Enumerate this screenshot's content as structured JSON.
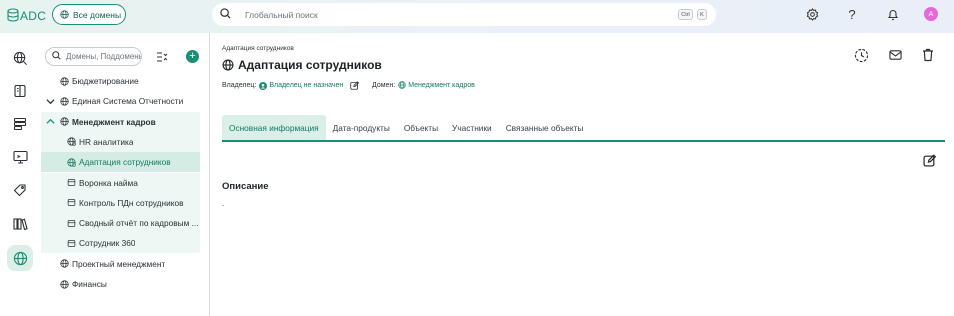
{
  "app": {
    "logo_text": "ADC",
    "brand_color": "#1a8f73"
  },
  "header": {
    "all_domains_label": "Все домены",
    "search_placeholder": "Глобальный поиск",
    "shortcut_keys": [
      "Ctrl",
      "K"
    ],
    "avatar_letter": "A"
  },
  "rail": {
    "icons": [
      "data-search-icon",
      "book-icon",
      "catalog-icon",
      "monitor-icon",
      "tag-icon",
      "library-icon",
      "globe-icon"
    ]
  },
  "tree": {
    "search_placeholder": "Домены, Поддомены",
    "items": [
      {
        "label": "Бюджетирование",
        "level": 0,
        "expanded": null
      },
      {
        "label": "Единая Система Отчетности",
        "level": 0,
        "expanded": false
      },
      {
        "label": "Менеджмент кадров",
        "level": 0,
        "expanded": true
      },
      {
        "label": "HR аналитика",
        "level": 1
      },
      {
        "label": "Адаптация сотрудников",
        "level": 1,
        "selected": true
      },
      {
        "label": "Воронка найма",
        "level": 1
      },
      {
        "label": "Контроль ПДн сотрудников",
        "level": 1
      },
      {
        "label": "Сводный отчёт по кадровым ...",
        "level": 1
      },
      {
        "label": "Сотрудник 360",
        "level": 1
      },
      {
        "label": "Проектный менеджмент",
        "level": 0
      },
      {
        "label": "Финансы",
        "level": 0
      }
    ]
  },
  "main": {
    "breadcrumb": "Адаптация сотрудников",
    "title": "Адаптация сотрудников",
    "owner_label": "Владелец:",
    "owner_value": "Владелец не назначен",
    "domain_label": "Домен:",
    "domain_value": "Менеджмент кадров",
    "tabs": [
      {
        "label": "Основная информация",
        "active": true
      },
      {
        "label": "Дата-продукты"
      },
      {
        "label": "Объекты"
      },
      {
        "label": "Участники"
      },
      {
        "label": "Связанные объекты"
      }
    ],
    "section_title": "Описание",
    "description": "."
  }
}
